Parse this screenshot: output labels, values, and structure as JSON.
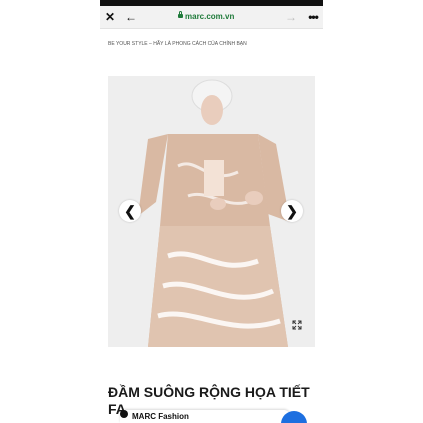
{
  "browser": {
    "close_glyph": "✕",
    "back_glyph": "←",
    "url": "marc.com.vn",
    "forward_glyph": "→",
    "more_glyph": "•••"
  },
  "page": {
    "tagline": "BE YOUR STYLE – HÃY LÀ PHONG CÁCH CỦA CHÍNH BẠN",
    "carousel": {
      "prev_glyph": "❮",
      "next_glyph": "❯"
    },
    "product_title": "ĐẦM SUÔNG RỘNG HỌA TIẾT FA..."
  },
  "bottom_bar": {
    "label": "MARC Fashion"
  },
  "colors": {
    "url_text": "#1f7a3a",
    "dress": "#d9b9a3",
    "chat_button": "#1d6fe0"
  }
}
